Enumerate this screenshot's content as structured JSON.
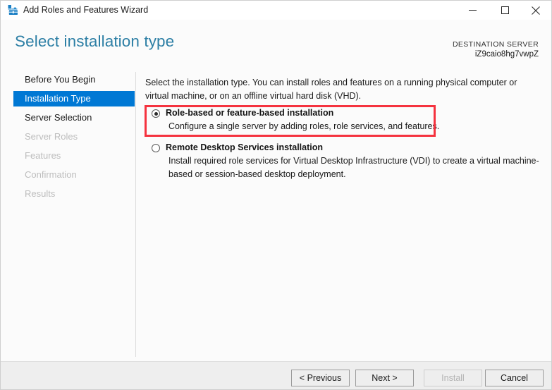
{
  "window": {
    "title": "Add Roles and Features Wizard",
    "icon": "server-manager-toolbox-icon",
    "controls": {
      "minimize": "minimize-icon",
      "maximize": "maximize-icon",
      "close": "close-icon"
    }
  },
  "header": {
    "page_title": "Select installation type",
    "destination_label": "DESTINATION SERVER",
    "destination_value": "iZ9caio8hg7vwpZ"
  },
  "sidebar": {
    "items": [
      {
        "label": "Before You Begin",
        "state": "enabled"
      },
      {
        "label": "Installation Type",
        "state": "selected"
      },
      {
        "label": "Server Selection",
        "state": "enabled"
      },
      {
        "label": "Server Roles",
        "state": "disabled"
      },
      {
        "label": "Features",
        "state": "disabled"
      },
      {
        "label": "Confirmation",
        "state": "disabled"
      },
      {
        "label": "Results",
        "state": "disabled"
      }
    ]
  },
  "content": {
    "intro": "Select the installation type. You can install roles and features on a running physical computer or virtual machine, or on an offline virtual hard disk (VHD).",
    "options": [
      {
        "title": "Role-based or feature-based installation",
        "description": "Configure a single server by adding roles, role services, and features.",
        "selected": true,
        "highlighted": true
      },
      {
        "title": "Remote Desktop Services installation",
        "description": "Install required role services for Virtual Desktop Infrastructure (VDI) to create a virtual machine-based or session-based desktop deployment.",
        "selected": false,
        "highlighted": false
      }
    ]
  },
  "footer": {
    "buttons": [
      {
        "label": "< Previous",
        "state": "enabled"
      },
      {
        "label": "Next >",
        "state": "enabled"
      },
      {
        "label": "Install",
        "state": "disabled"
      },
      {
        "label": "Cancel",
        "state": "enabled"
      }
    ]
  },
  "colors": {
    "accent_blue": "#0078d4",
    "title_blue": "#2d7fa5",
    "annotation_red": "#f5333f",
    "footer_gray": "#eeeeee",
    "disabled_text": "#bdbdbd"
  }
}
